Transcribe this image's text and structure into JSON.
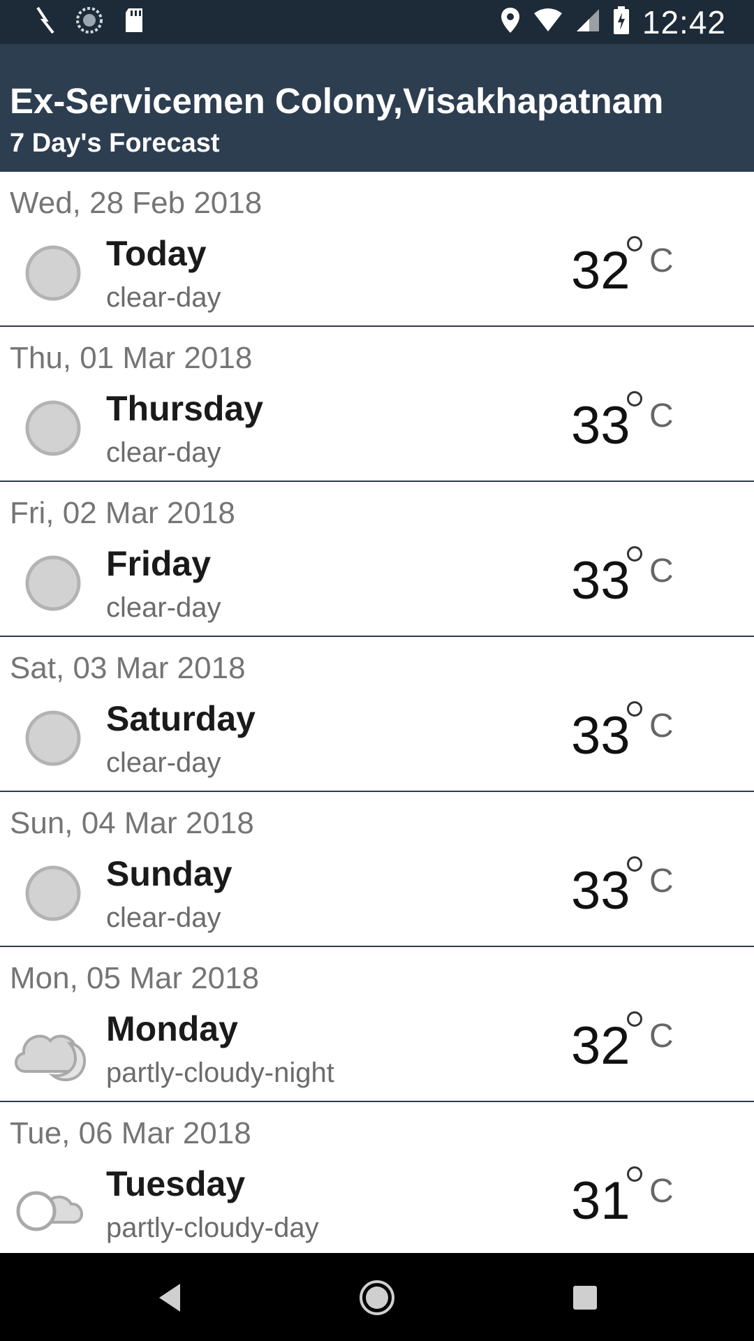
{
  "status_bar": {
    "time": "12:42",
    "left_icons": [
      "charging-bolt-icon",
      "sync-icon",
      "sd-card-icon"
    ],
    "right_icons": [
      "location-icon",
      "wifi-icon",
      "signal-icon",
      "battery-charging-icon"
    ]
  },
  "header": {
    "location": "Ex-Servicemen Colony,Visakhapatnam",
    "subtitle": "7 Day's Forecast",
    "background": "#2e3e51"
  },
  "forecast": [
    {
      "date": "Wed, 28 Feb 2018",
      "day": "Today",
      "condition": "clear-day",
      "temp": "32",
      "unit": "C",
      "icon": "clear-day-icon"
    },
    {
      "date": "Thu, 01 Mar 2018",
      "day": "Thursday",
      "condition": "clear-day",
      "temp": "33",
      "unit": "C",
      "icon": "clear-day-icon"
    },
    {
      "date": "Fri, 02 Mar 2018",
      "day": "Friday",
      "condition": "clear-day",
      "temp": "33",
      "unit": "C",
      "icon": "clear-day-icon"
    },
    {
      "date": "Sat, 03 Mar 2018",
      "day": "Saturday",
      "condition": "clear-day",
      "temp": "33",
      "unit": "C",
      "icon": "clear-day-icon"
    },
    {
      "date": "Sun, 04 Mar 2018",
      "day": "Sunday",
      "condition": "clear-day",
      "temp": "33",
      "unit": "C",
      "icon": "clear-day-icon"
    },
    {
      "date": "Mon, 05 Mar 2018",
      "day": "Monday",
      "condition": "partly-cloudy-night",
      "temp": "32",
      "unit": "C",
      "icon": "partly-cloudy-night-icon"
    },
    {
      "date": "Tue, 06 Mar 2018",
      "day": "Tuesday",
      "condition": "partly-cloudy-day",
      "temp": "31",
      "unit": "C",
      "icon": "partly-cloudy-day-icon"
    }
  ],
  "nav_bar": {
    "buttons": [
      "back-icon",
      "home-icon",
      "recents-icon"
    ]
  },
  "colors": {
    "status_bar": "#1d2a38",
    "header": "#2e3e51",
    "divider": "#2f3c4c",
    "icon_gray": "#bdbdbd"
  }
}
